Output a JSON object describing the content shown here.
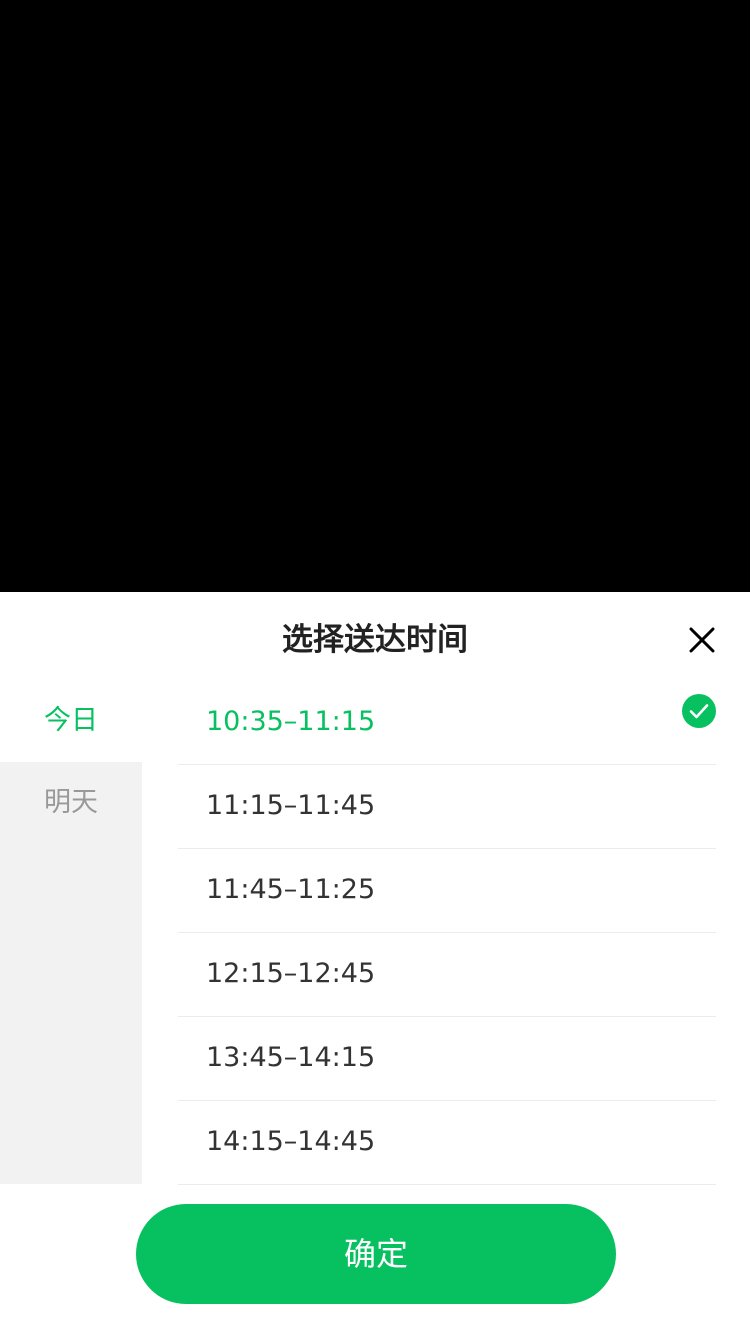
{
  "sheet": {
    "title": "选择送达时间"
  },
  "icons": {
    "close": "close-icon",
    "selected": "check-circle-icon"
  },
  "dates": [
    {
      "label": "今日",
      "active": true
    },
    {
      "label": "明天",
      "active": false
    }
  ],
  "slots": [
    {
      "label": "10:35–11:15",
      "selected": true
    },
    {
      "label": "11:15–11:45",
      "selected": false
    },
    {
      "label": "11:45–11:25",
      "selected": false
    },
    {
      "label": "12:15–12:45",
      "selected": false
    },
    {
      "label": "13:45–14:15",
      "selected": false
    },
    {
      "label": "14:15–14:45",
      "selected": false
    }
  ],
  "confirm_label": "确定",
  "colors": {
    "accent": "#07c160",
    "text": "#333333",
    "muted": "#999999",
    "sidebar": "#f2f2f2"
  }
}
